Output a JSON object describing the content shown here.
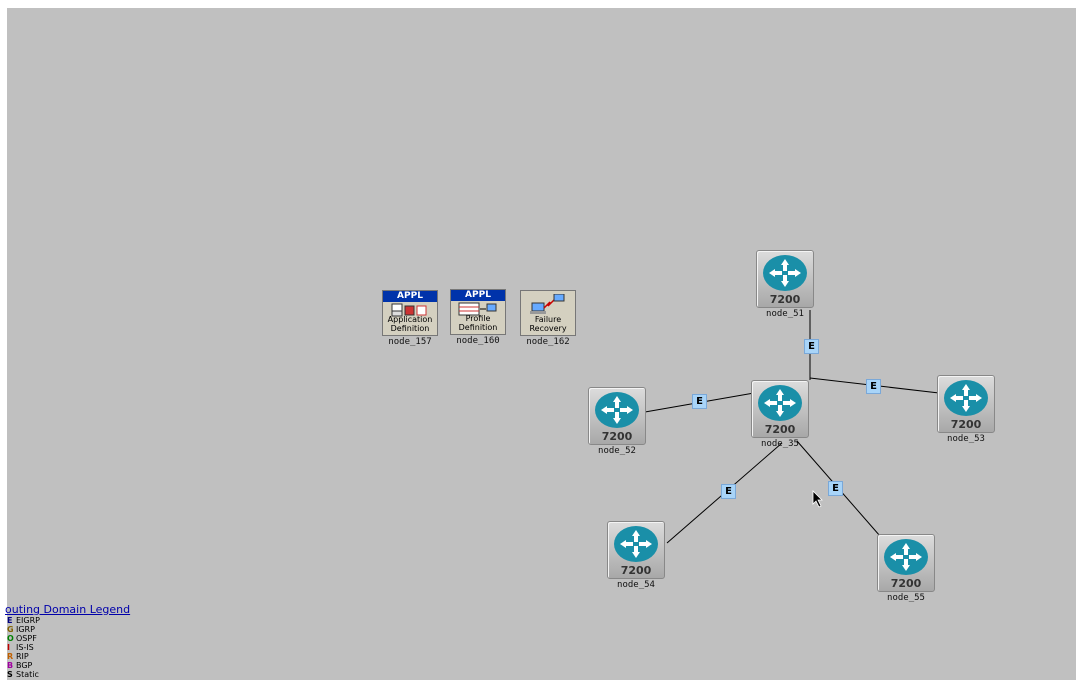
{
  "routers": [
    {
      "id": "node_51",
      "model": "7200",
      "label": "node_51"
    },
    {
      "id": "node_35",
      "model": "7200",
      "label": "node_35"
    },
    {
      "id": "node_52",
      "model": "7200",
      "label": "node_52"
    },
    {
      "id": "node_53",
      "model": "7200",
      "label": "node_53"
    },
    {
      "id": "node_54",
      "model": "7200",
      "label": "node_54"
    },
    {
      "id": "node_55",
      "model": "7200",
      "label": "node_55"
    }
  ],
  "config_objects": [
    {
      "id": "node_157",
      "tag": "APPL",
      "name_line1": "Application",
      "name_line2": "Definition",
      "label": "node_157"
    },
    {
      "id": "node_160",
      "tag": "APPL",
      "name_line1": "Profile",
      "name_line2": "Definition",
      "label": "node_160"
    },
    {
      "id": "node_162",
      "tag": "",
      "name_line1": "Failure",
      "name_line2": "Recovery",
      "label": "node_162"
    }
  ],
  "link_badges": [
    "E",
    "E",
    "E",
    "E",
    "E"
  ],
  "legend": {
    "title": "outing Domain Legend",
    "items": [
      {
        "code": "E",
        "name": "EIGRP",
        "color": "#000080"
      },
      {
        "code": "G",
        "name": "IGRP",
        "color": "#806000"
      },
      {
        "code": "O",
        "name": "OSPF",
        "color": "#008000"
      },
      {
        "code": "I",
        "name": "IS-IS",
        "color": "#c00000"
      },
      {
        "code": "R",
        "name": "RIP",
        "color": "#c06000"
      },
      {
        "code": "B",
        "name": "BGP",
        "color": "#a000a0"
      },
      {
        "code": "S",
        "name": "Static",
        "color": "#000000"
      }
    ]
  },
  "colors": {
    "canvas": "#c0c0c0",
    "router": "#1a8fa8",
    "badge": "#a8d4f8"
  }
}
